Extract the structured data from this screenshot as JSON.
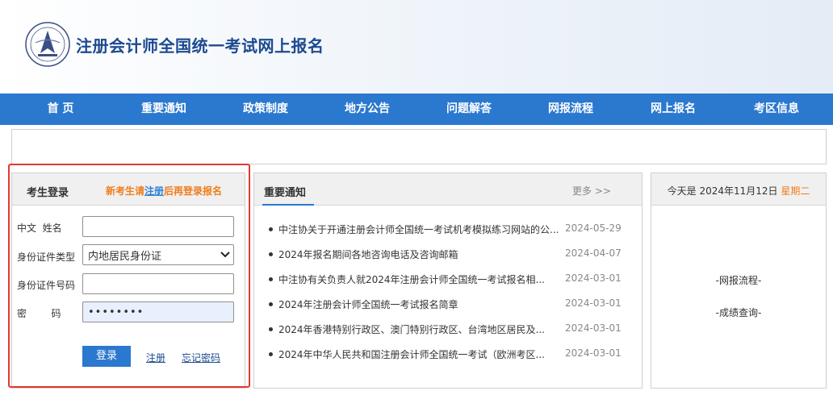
{
  "header": {
    "title": "注册会计师全国统一考试网上报名",
    "logo_icon": "cicpa-seal-icon"
  },
  "nav": {
    "items": [
      "首 页",
      "重要通知",
      "政策制度",
      "地方公告",
      "问题解答",
      "网报流程",
      "网上报名",
      "考区信息"
    ]
  },
  "login": {
    "title": "考生登录",
    "hint_prefix": "新考生请",
    "hint_register": "注册",
    "hint_suffix": "后再登录报名",
    "name_label": "中文  姓名",
    "name_value": "",
    "id_type_label": "身份证件类型",
    "id_type_value": "内地居民身份证",
    "id_no_label": "身份证件号码",
    "id_no_value": "",
    "password_label": "密        码",
    "password_value": "••••••••",
    "login_button": "登录",
    "register_link": "注册",
    "forgot_link": "忘记密码"
  },
  "notice": {
    "title": "重要通知",
    "more": "更多 >>",
    "items": [
      {
        "text": "中注协关于开通注册会计师全国统一考试机考模拟练习网站的公...",
        "date": "2024-05-29"
      },
      {
        "text": "2024年报名期间各地咨询电话及咨询邮箱",
        "date": "2024-04-07"
      },
      {
        "text": "中注协有关负责人就2024年注册会计师全国统一考试报名相...",
        "date": "2024-03-01"
      },
      {
        "text": "2024年注册会计师全国统一考试报名简章",
        "date": "2024-03-01"
      },
      {
        "text": "2024年香港特别行政区、澳门特别行政区、台湾地区居民及...",
        "date": "2024-03-01"
      },
      {
        "text": "2024年中华人民共和国注册会计师全国统一考试（欧洲考区...",
        "date": "2024-03-01"
      }
    ]
  },
  "side": {
    "date_prefix": "今天是 2024年11月12日 ",
    "weekday": "星期二",
    "link_process": "-网报流程-",
    "link_score": "-成绩查询-"
  },
  "colors": {
    "nav_bg": "#2b78cf",
    "title_blue": "#1c4a8f",
    "hint_orange": "#f07d1c",
    "highlight_red": "#e03a2f"
  }
}
